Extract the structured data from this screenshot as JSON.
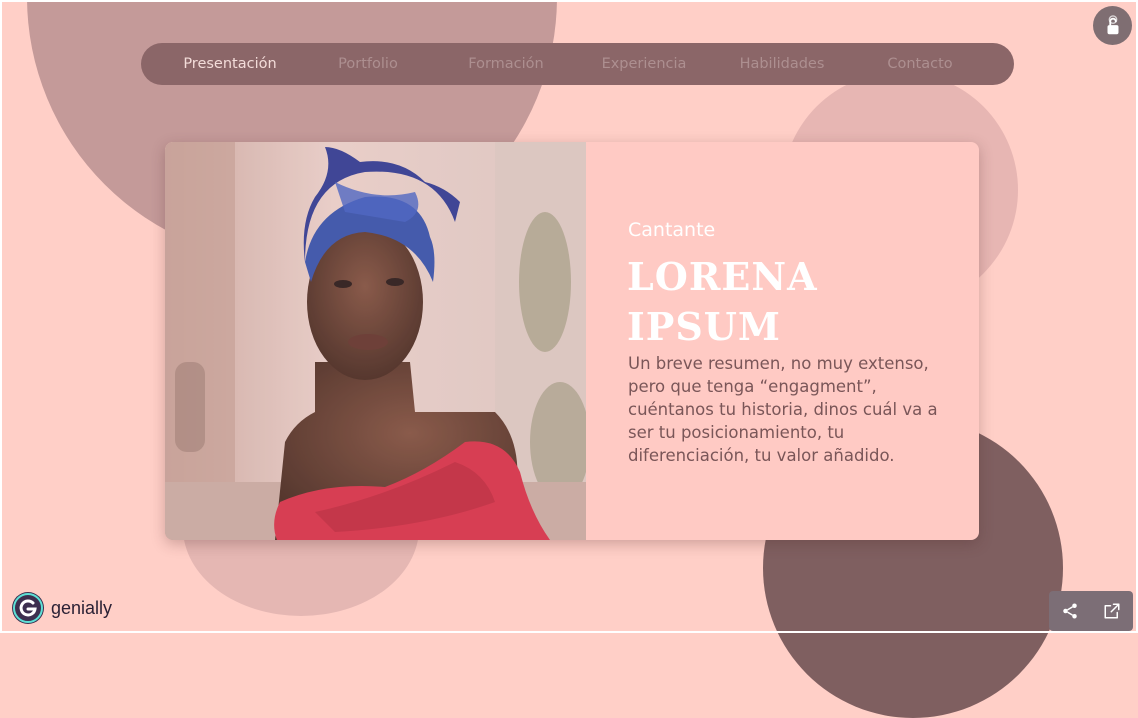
{
  "nav": {
    "items": [
      {
        "label": "Presentación",
        "active": true
      },
      {
        "label": "Portfolio",
        "active": false
      },
      {
        "label": "Formación",
        "active": false
      },
      {
        "label": "Experiencia",
        "active": false
      },
      {
        "label": "Habilidades",
        "active": false
      },
      {
        "label": "Contacto",
        "active": false
      }
    ]
  },
  "profile": {
    "role": "Cantante",
    "name_line1": "LORENA",
    "name_line2": "IPSUM",
    "summary": "Un breve resumen, no muy extenso, pero que tenga “engagment”, cuéntanos tu historia, dinos cuál va a ser tu posicionamiento, tu diferenciación, tu valor añadido."
  },
  "brand": {
    "name": "genially"
  },
  "icons": {
    "top_right": "touch-lock-icon",
    "share": "share-icon",
    "fullscreen": "external-link-icon"
  },
  "colors": {
    "background": "#ffcfc7",
    "nav": "#8b6668",
    "card": "#ffcac4",
    "accent_dark": "#7f5f60"
  }
}
